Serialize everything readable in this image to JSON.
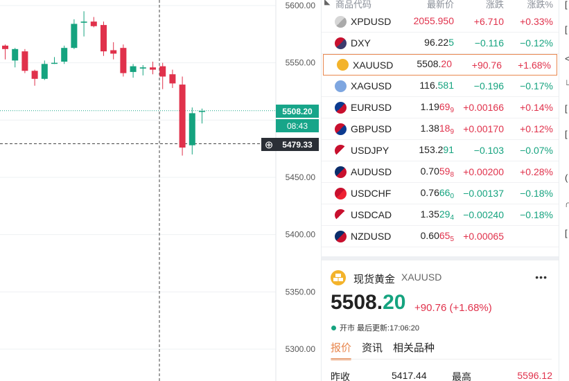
{
  "chart": {
    "y_ticks": [
      "5600.00",
      "5550.00",
      "5450.00",
      "5400.00",
      "5350.00",
      "5300.00"
    ],
    "current_price": "5508.20",
    "countdown": "08:43",
    "crosshair_price": "5479.33",
    "colors": {
      "up": "#e0314b",
      "down": "#15a37f"
    },
    "candles": [
      {
        "o": 5565,
        "h": 5566,
        "l": 5553,
        "c": 5562
      },
      {
        "o": 5552,
        "h": 5563,
        "l": 5546,
        "c": 5562
      },
      {
        "o": 5560,
        "h": 5562,
        "l": 5541,
        "c": 5543
      },
      {
        "o": 5543,
        "h": 5544,
        "l": 5530,
        "c": 5536
      },
      {
        "o": 5536,
        "h": 5552,
        "l": 5535,
        "c": 5549
      },
      {
        "o": 5550,
        "h": 5555,
        "l": 5549,
        "c": 5550
      },
      {
        "o": 5551,
        "h": 5565,
        "l": 5549,
        "c": 5563
      },
      {
        "o": 5563,
        "h": 5588,
        "l": 5562,
        "c": 5584
      },
      {
        "o": 5585,
        "h": 5595,
        "l": 5573,
        "c": 5586
      },
      {
        "o": 5586,
        "h": 5590,
        "l": 5581,
        "c": 5582
      },
      {
        "o": 5583,
        "h": 5586,
        "l": 5556,
        "c": 5560
      },
      {
        "o": 5561,
        "h": 5568,
        "l": 5553,
        "c": 5558
      },
      {
        "o": 5563,
        "h": 5566,
        "l": 5538,
        "c": 5541
      },
      {
        "o": 5542,
        "h": 5549,
        "l": 5537,
        "c": 5547
      },
      {
        "o": 5545,
        "h": 5548,
        "l": 5539,
        "c": 5546
      },
      {
        "o": 5546,
        "h": 5551,
        "l": 5540,
        "c": 5544
      },
      {
        "o": 5547,
        "h": 5550,
        "l": 5527,
        "c": 5538
      },
      {
        "o": 5540,
        "h": 5544,
        "l": 5528,
        "c": 5532
      },
      {
        "o": 5531,
        "h": 5538,
        "l": 5469,
        "c": 5476
      },
      {
        "o": 5478,
        "h": 5511,
        "l": 5470,
        "c": 5506
      },
      {
        "o": 5508,
        "h": 5510,
        "l": 5497,
        "c": 5508
      }
    ]
  },
  "quotes": {
    "headers": {
      "symbol": "商品代码",
      "last": "最新价",
      "change": "涨跌",
      "pct": "涨跌%"
    },
    "rows": [
      {
        "symbol": "XPDUSD",
        "last_main": "2055.950",
        "last_hi": "",
        "last_sub": "",
        "change": "+6.710",
        "pct": "+0.33%",
        "dir": "up",
        "last_color": "up",
        "flag": "silver-coin-icon",
        "selected": false
      },
      {
        "symbol": "DXY",
        "last_main": "96.22",
        "last_hi": "5",
        "last_sub": "",
        "change": "−0.116",
        "pct": "−0.12%",
        "dir": "down",
        "last_color": "",
        "flag": "us-flag-icon",
        "selected": false
      },
      {
        "symbol": "XAUUSD",
        "last_main": "5508.",
        "last_hi": "20",
        "last_sub": "",
        "change": "+90.76",
        "pct": "+1.68%",
        "dir": "up",
        "last_color": "",
        "flag": "gold-coin-icon",
        "selected": true
      },
      {
        "symbol": "XAGUSD",
        "last_main": "116.",
        "last_hi": "581",
        "last_sub": "",
        "change": "−0.196",
        "pct": "−0.17%",
        "dir": "down",
        "last_color": "",
        "flag": "silver-bar-icon",
        "selected": false
      },
      {
        "symbol": "EURUSD",
        "last_main": "1.19",
        "last_hi": "69",
        "last_sub": "9",
        "change": "+0.00166",
        "pct": "+0.14%",
        "dir": "up",
        "last_color": "",
        "flag": "eu-us-flag-icon",
        "selected": false
      },
      {
        "symbol": "GBPUSD",
        "last_main": "1.38",
        "last_hi": "18",
        "last_sub": "9",
        "change": "+0.00170",
        "pct": "+0.12%",
        "dir": "up",
        "last_color": "",
        "flag": "gb-us-flag-icon",
        "selected": false
      },
      {
        "symbol": "USDJPY",
        "last_main": "153.2",
        "last_hi": "91",
        "last_sub": "",
        "change": "−0.103",
        "pct": "−0.07%",
        "dir": "down",
        "last_color": "",
        "flag": "us-jp-flag-icon",
        "selected": false
      },
      {
        "symbol": "AUDUSD",
        "last_main": "0.70",
        "last_hi": "59",
        "last_sub": "8",
        "change": "+0.00200",
        "pct": "+0.28%",
        "dir": "up",
        "last_color": "",
        "flag": "au-us-flag-icon",
        "selected": false
      },
      {
        "symbol": "USDCHF",
        "last_main": "0.76",
        "last_hi": "66",
        "last_sub": "0",
        "change": "−0.00137",
        "pct": "−0.18%",
        "dir": "down",
        "last_color": "",
        "flag": "us-ch-flag-icon",
        "selected": false
      },
      {
        "symbol": "USDCAD",
        "last_main": "1.35",
        "last_hi": "29",
        "last_sub": "4",
        "change": "−0.00240",
        "pct": "−0.18%",
        "dir": "down",
        "last_color": "",
        "flag": "us-ca-flag-icon",
        "selected": false
      },
      {
        "symbol": "NZDUSD",
        "last_main": "0.60",
        "last_hi": "65",
        "last_sub": "5",
        "change": "+0.00065",
        "pct": "",
        "dir": "up",
        "last_color": "",
        "flag": "nz-us-flag-icon",
        "selected": false
      }
    ]
  },
  "detail": {
    "name": "现货黄金",
    "code": "XAUUSD",
    "more": "•••",
    "price_int": "5508.",
    "price_dec": "20",
    "change": "+90.76 (+1.68%)",
    "status": "开市 最后更新:17:06:20",
    "tabs": [
      "报价",
      "资讯",
      "相关品种"
    ],
    "stats": {
      "prev_close_label": "昨收",
      "prev_close": "5417.44",
      "high_label": "最高",
      "high": "5596.12"
    }
  }
}
